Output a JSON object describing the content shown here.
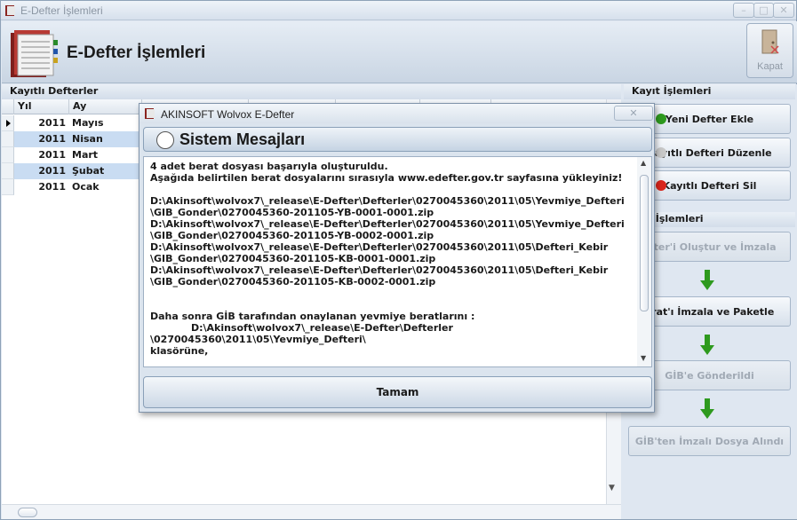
{
  "window": {
    "title": "E-Defter İşlemleri",
    "min_label": "–",
    "max_label": "□",
    "close_label": "✕"
  },
  "header": {
    "title": "E-Defter İşlemleri",
    "kapat_label": "Kapat"
  },
  "grid": {
    "group_title": "Kayıtlı Defterler",
    "columns": [
      "Yıl",
      "Ay"
    ],
    "rows": [
      {
        "yil": "2011",
        "ay": "Mayıs"
      },
      {
        "yil": "2011",
        "ay": "Nisan"
      },
      {
        "yil": "2011",
        "ay": "Mart"
      },
      {
        "yil": "2011",
        "ay": "Şubat"
      },
      {
        "yil": "2011",
        "ay": "Ocak"
      }
    ]
  },
  "right": {
    "group1_title": "Kayıt İşlemleri",
    "btn_yeni": "Yeni Defter Ekle",
    "btn_duzenle": "Kayıtlı Defteri Düzenle",
    "btn_sil": "Kayıtlı Defteri Sil",
    "group2_title": "fter İşlemleri",
    "btn_olustur": "efter'i Oluştur ve İmzala",
    "btn_berat": "erat'ı İmzala ve Paketle",
    "btn_gib_gonder": "GİB'e Gönderildi",
    "btn_gib_alindi": "GİB'ten İmzalı Dosya Alındı"
  },
  "dialog": {
    "title": "AKINSOFT Wolvox E-Defter",
    "close_label": "✕",
    "header": "Sistem Mesajları",
    "message": "4 adet berat dosyası başarıyla oluşturuldu.\nAşağıda belirtilen berat dosyalarını sırasıyla www.edefter.gov.tr sayfasına yükleyiniz!\n\nD:\\Akinsoft\\wolvox7\\_release\\E-Defter\\Defterler\\0270045360\\2011\\05\\Yevmiye_Defteri\n\\GIB_Gonder\\0270045360-201105-YB-0001-0001.zip\nD:\\Akinsoft\\wolvox7\\_release\\E-Defter\\Defterler\\0270045360\\2011\\05\\Yevmiye_Defteri\n\\GIB_Gonder\\0270045360-201105-YB-0002-0001.zip\nD:\\Akinsoft\\wolvox7\\_release\\E-Defter\\Defterler\\0270045360\\2011\\05\\Defteri_Kebir\n\\GIB_Gonder\\0270045360-201105-KB-0001-0001.zip\nD:\\Akinsoft\\wolvox7\\_release\\E-Defter\\Defterler\\0270045360\\2011\\05\\Defteri_Kebir\n\\GIB_Gonder\\0270045360-201105-KB-0002-0001.zip\n\n\nDaha sonra GİB tarafından onaylanan yevmiye beratlarını :\n            D:\\Akinsoft\\wolvox7\\_release\\E-Defter\\Defterler\n\\0270045360\\2011\\05\\Yevmiye_Defteri\\\nklasörüne,",
    "ok_label": "Tamam"
  },
  "colors": {
    "accent_green": "#2e9a1e",
    "accent_red": "#d9251b",
    "selection_blue": "#c9dcf2"
  }
}
